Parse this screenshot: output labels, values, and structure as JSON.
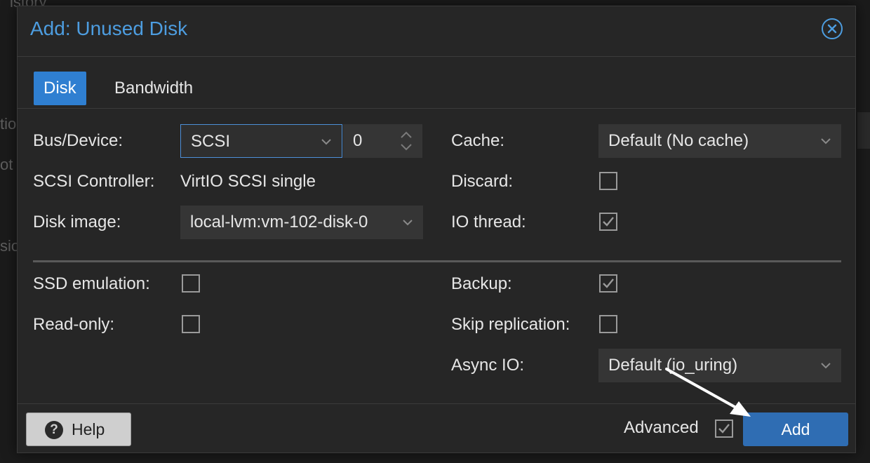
{
  "background": {
    "fragments": [
      "istory",
      "tio",
      "ot",
      "sio"
    ]
  },
  "dialog": {
    "title": "Add: Unused Disk",
    "close_icon": "close-circle-icon"
  },
  "tabs": [
    {
      "label": "Disk",
      "active": true
    },
    {
      "label": "Bandwidth",
      "active": false
    }
  ],
  "form": {
    "bus_device": {
      "label": "Bus/Device:",
      "bus": "SCSI",
      "device": "0"
    },
    "scsi_controller": {
      "label": "SCSI Controller:",
      "value": "VirtIO SCSI single"
    },
    "disk_image": {
      "label": "Disk image:",
      "value": "local-lvm:vm-102-disk-0"
    },
    "cache": {
      "label": "Cache:",
      "value": "Default (No cache)"
    },
    "discard": {
      "label": "Discard:",
      "checked": false
    },
    "io_thread": {
      "label": "IO thread:",
      "checked": true
    },
    "ssd_emulation": {
      "label": "SSD emulation:",
      "checked": false
    },
    "read_only": {
      "label": "Read-only:",
      "checked": false
    },
    "backup": {
      "label": "Backup:",
      "checked": true
    },
    "skip_replication": {
      "label": "Skip replication:",
      "checked": false
    },
    "async_io": {
      "label": "Async IO:",
      "value": "Default (io_uring)"
    }
  },
  "footer": {
    "help_label": "Help",
    "help_icon_glyph": "?",
    "advanced_label": "Advanced",
    "advanced_checked": true,
    "add_label": "Add"
  },
  "colors": {
    "accent": "#4d9de0",
    "active_tab": "#2f7fd1",
    "primary_button": "#2f6db3"
  }
}
